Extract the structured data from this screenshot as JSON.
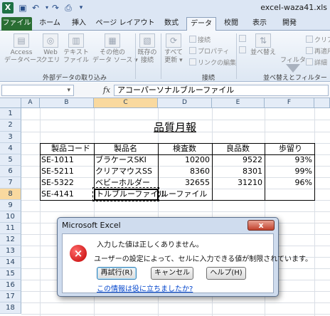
{
  "window": {
    "title": "excel-waza41.xls"
  },
  "quick_access": {
    "logo": "X",
    "save_icon": "save-icon",
    "undo_icon": "undo-icon",
    "redo_icon": "redo-icon"
  },
  "tabs": {
    "file": "ファイル",
    "home": "ホーム",
    "insert": "挿入",
    "page_layout": "ページ レイアウト",
    "formulas": "数式",
    "data": "データ",
    "review": "校閲",
    "view": "表示",
    "developer": "開発"
  },
  "ribbon": {
    "access": "Access\nデータベース",
    "web": "Web\nクエリ",
    "text": "テキスト\nファイル",
    "other": "その他の\nデータ ソース ▾",
    "existing": "既存の\n接続",
    "refresh": "すべて\n更新 ▾",
    "connections": "接続",
    "properties": "プロパティ",
    "edit_links": "リンクの編集",
    "sort": "並べ替え",
    "filter": "フィルター",
    "clear": "クリア",
    "reapply": "再適用",
    "advanced": "詳細",
    "group_external": "外部データの取り込み",
    "group_connections": "接続",
    "group_sort_filter": "並べ替えとフィルター"
  },
  "formula_bar": {
    "name_box": "▾",
    "fx": "fx",
    "content": "アコーパーソナルブルーファイル"
  },
  "columns": [
    "A",
    "B",
    "C",
    "D",
    "E",
    "F"
  ],
  "rows": [
    "1",
    "2",
    "3",
    "4",
    "5",
    "6",
    "7",
    "8",
    "9",
    "10",
    "11",
    "12",
    "13",
    "14",
    "15",
    "16",
    "17",
    "18",
    "19",
    "20"
  ],
  "sheet": {
    "title": "品質月報",
    "headers": [
      "製品コード",
      "製品名",
      "検査数",
      "良品数",
      "歩留り"
    ],
    "data": [
      [
        "SE-1011",
        "ブラケースSKI",
        "10200",
        "9522",
        "93%"
      ],
      [
        "SE-5211",
        "クリアマウスSS",
        "8360",
        "8301",
        "99%"
      ],
      [
        "SE-5322",
        "ベビーホルダー",
        "32655",
        "31210",
        "96%"
      ],
      [
        "SE-4141",
        "",
        "",
        "",
        ""
      ]
    ],
    "editing_text": "トルブルーファイル",
    "overflow_text": "ルーファイル"
  },
  "dialog": {
    "title": "Microsoft Excel",
    "close": "x",
    "message1": "入力した値は正しくありません。",
    "message2": "ユーザーの設定によって、セルに入力できる値が制限されています。",
    "retry": "再試行(R)",
    "cancel": "キャンセル",
    "help": "ヘルプ(H)",
    "link": "この情報は役に立ちましたか?",
    "error_icon_glyph": "×"
  }
}
